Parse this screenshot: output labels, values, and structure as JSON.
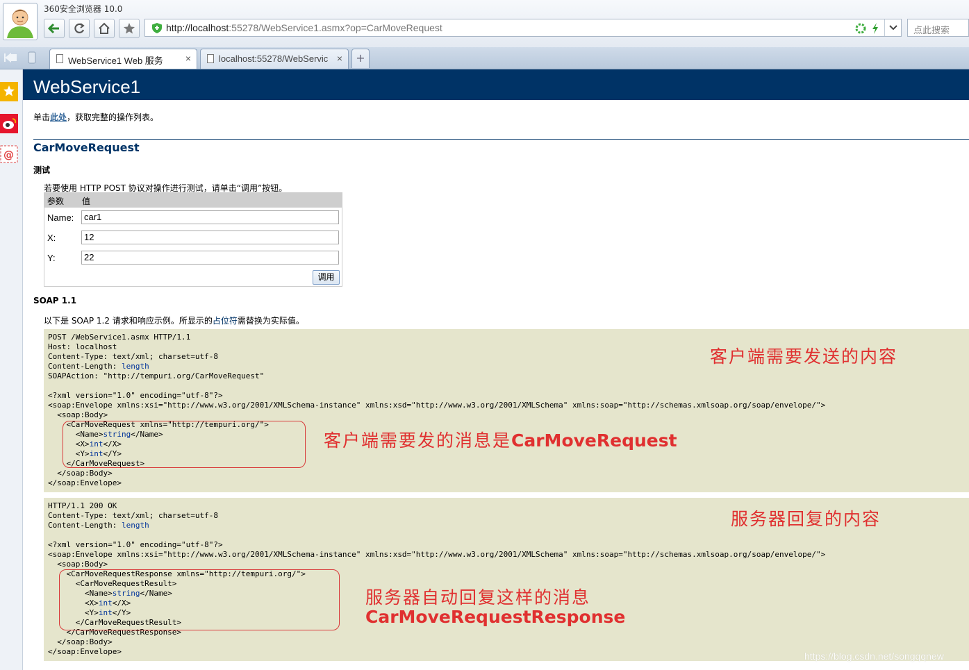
{
  "browser": {
    "app_title": "360安全浏览器 10.0",
    "url_host": "http://localhost",
    "url_rest": ":55278/WebService1.asmx?op=CarMoveRequest",
    "search_placeholder": "点此搜索",
    "tabs": [
      {
        "label": "WebService1 Web 服务",
        "close": "×"
      },
      {
        "label": "localhost:55278/WebServic",
        "close": "×"
      }
    ],
    "new_tab": "+"
  },
  "page": {
    "title": "WebService1",
    "intro_prefix": "单击",
    "intro_link": "此处",
    "intro_suffix": "，获取完整的操作列表。",
    "operation": "CarMoveRequest",
    "test_heading": "测试",
    "test_note": "若要使用 HTTP POST 协议对操作进行测试，请单击“调用”按钮。",
    "param_header": "参数",
    "value_header": "值",
    "params": [
      {
        "label": "Name:",
        "value": "car1"
      },
      {
        "label": "X:",
        "value": "12"
      },
      {
        "label": "Y:",
        "value": "22"
      }
    ],
    "invoke_label": "调用",
    "soap_heading": "SOAP 1.1",
    "soap_note_prefix": "以下是 SOAP 1.2 请求和响应示例。所显示的",
    "soap_note_ph": "占位符",
    "soap_note_suffix": "需替换为实际值。"
  },
  "request": {
    "lines": [
      "POST /WebService1.asmx HTTP/1.1",
      "Host: localhost",
      "Content-Type: text/xml; charset=utf-8",
      "Content-Length: ",
      "SOAPAction: \"http://tempuri.org/CarMoveRequest\"",
      "",
      "<?xml version=\"1.0\" encoding=\"utf-8\"?>",
      "<soap:Envelope xmlns:xsi=\"http://www.w3.org/2001/XMLSchema-instance\" xmlns:xsd=\"http://www.w3.org/2001/XMLSchema\" xmlns:soap=\"http://schemas.xmlsoap.org/soap/envelope/\">",
      "  <soap:Body>",
      "    <CarMoveRequest xmlns=\"http://tempuri.org/\">",
      "      <Name>",
      "      <X>",
      "      <Y>",
      "    </CarMoveRequest>",
      "  </soap:Body>",
      "</soap:Envelope>"
    ],
    "placeholders": {
      "length": "length",
      "string": "string",
      "int": "int"
    },
    "tail_name": "</Name>",
    "tail_x": "</X>",
    "tail_y": "</Y>"
  },
  "response": {
    "lines": [
      "HTTP/1.1 200 OK",
      "Content-Type: text/xml; charset=utf-8",
      "Content-Length: ",
      "",
      "<?xml version=\"1.0\" encoding=\"utf-8\"?>",
      "<soap:Envelope xmlns:xsi=\"http://www.w3.org/2001/XMLSchema-instance\" xmlns:xsd=\"http://www.w3.org/2001/XMLSchema\" xmlns:soap=\"http://schemas.xmlsoap.org/soap/envelope/\">",
      "  <soap:Body>",
      "    <CarMoveRequestResponse xmlns=\"http://tempuri.org/\">",
      "      <CarMoveRequestResult>",
      "        <Name>",
      "        <X>",
      "        <Y>",
      "      </CarMoveRequestResult>",
      "    </CarMoveRequestResponse>",
      "  </soap:Body>",
      "</soap:Envelope>"
    ]
  },
  "annotations": {
    "client_content": "客户端需要发送的内容",
    "client_message_prefix": "客户端需要发的消息是",
    "client_message_name": "CarMoveRequest",
    "server_content": "服务器回复的内容",
    "server_message_prefix": "服务器自动回复这样的消息",
    "server_message_name": "CarMoveRequestResponse",
    "color": "#e03030"
  },
  "watermark": "https://blog.csdn.net/songqqnew",
  "colors": {
    "banner": "#003366",
    "code_bg": "#e5e5cc",
    "link": "#336699"
  }
}
